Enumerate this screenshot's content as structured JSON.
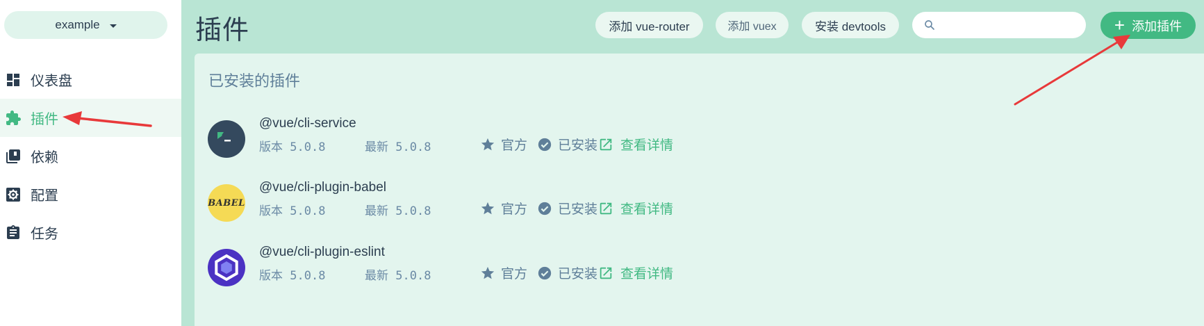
{
  "sidebar": {
    "project": "example",
    "items": [
      {
        "label": "仪表盘",
        "icon": "dashboard-icon",
        "active": false
      },
      {
        "label": "插件",
        "icon": "puzzle-icon",
        "active": true
      },
      {
        "label": "依赖",
        "icon": "library-icon",
        "active": false
      },
      {
        "label": "配置",
        "icon": "gear-icon",
        "active": false
      },
      {
        "label": "任务",
        "icon": "clipboard-icon",
        "active": false
      }
    ]
  },
  "header": {
    "title": "插件",
    "buttons": {
      "vue_router": "添加 vue-router",
      "vuex": "添加 vuex",
      "devtools": "安装 devtools"
    },
    "search": {
      "value": "",
      "placeholder": ""
    },
    "add_plugin": "添加插件"
  },
  "panel": {
    "title": "已安装的插件",
    "plugins": [
      {
        "name": "@vue/cli-service",
        "version_label": "版本",
        "version": "5.0.8",
        "latest_label": "最新",
        "latest": "5.0.8",
        "official": "官方",
        "installed": "已安装",
        "details": "查看详情",
        "logo": "terminal-logo"
      },
      {
        "name": "@vue/cli-plugin-babel",
        "version_label": "版本",
        "version": "5.0.8",
        "latest_label": "最新",
        "latest": "5.0.8",
        "official": "官方",
        "installed": "已安装",
        "details": "查看详情",
        "logo": "babel-logo",
        "logo_text": "BABEL"
      },
      {
        "name": "@vue/cli-plugin-eslint",
        "version_label": "版本",
        "version": "5.0.8",
        "latest_label": "最新",
        "latest": "5.0.8",
        "official": "官方",
        "installed": "已安装",
        "details": "查看详情",
        "logo": "eslint-logo"
      }
    ]
  },
  "colors": {
    "accent": "#42b983",
    "header_bg": "#b9e5d4",
    "panel_bg": "#e3f5ee",
    "text": "#2c3e50",
    "muted": "#5f7f99",
    "annotation": "#e8393a"
  }
}
